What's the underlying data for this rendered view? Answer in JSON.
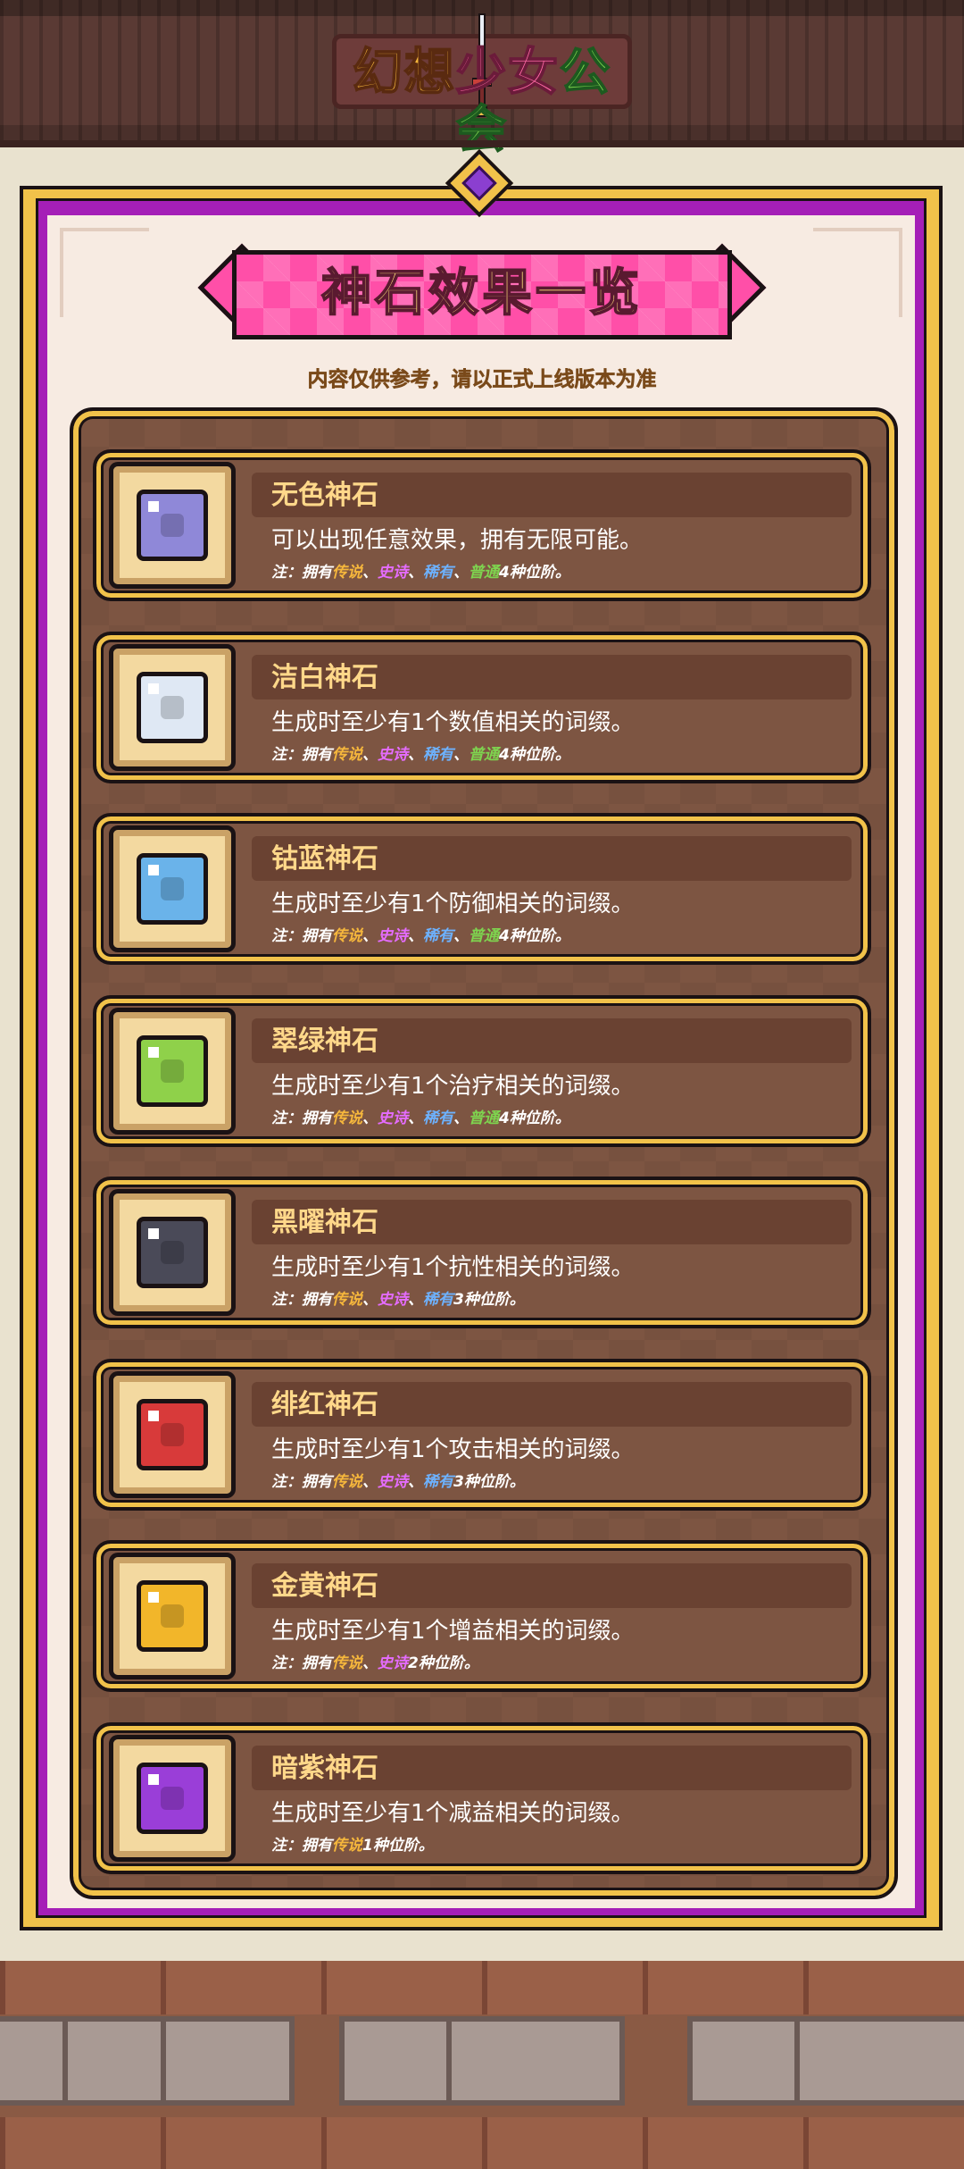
{
  "logo": {
    "part1": "幻想",
    "part2": "少女",
    "part3": "公会"
  },
  "title": "神石效果一览",
  "subtitle": "内容仅供参考，请以正式上线版本为准",
  "colors": {
    "legend": "#f6b73c",
    "epic": "#e56cff",
    "rare": "#6db2ff",
    "common": "#7ed44f",
    "frame": "#a51fb7",
    "title_bg": "#ff4fa8"
  },
  "stones": [
    {
      "name": "无色神石",
      "desc": "可以出现任意效果，拥有无限可能。",
      "gem_color": "#8f88d8",
      "icon": "colorless-stone-icon",
      "note": {
        "prefix": "注：拥有",
        "tiers": [
          "传说",
          "史诗",
          "稀有",
          "普通"
        ],
        "seps": [
          "、",
          "、",
          "、"
        ],
        "suffix": "4种位阶。"
      }
    },
    {
      "name": "洁白神石",
      "desc": "生成时至少有1个数值相关的词缀。",
      "gem_color": "#dfe8f4",
      "icon": "white-stone-icon",
      "note": {
        "prefix": "注：拥有",
        "tiers": [
          "传说",
          "史诗",
          "稀有",
          "普通"
        ],
        "seps": [
          "、",
          "、",
          "、"
        ],
        "suffix": "4种位阶。"
      }
    },
    {
      "name": "钴蓝神石",
      "desc": "生成时至少有1个防御相关的词缀。",
      "gem_color": "#6ab3ea",
      "icon": "cobalt-stone-icon",
      "note": {
        "prefix": "注：拥有",
        "tiers": [
          "传说",
          "史诗",
          "稀有",
          "普通"
        ],
        "seps": [
          "、",
          "、",
          "、"
        ],
        "suffix": "4种位阶。"
      }
    },
    {
      "name": "翠绿神石",
      "desc": "生成时至少有1个治疗相关的词缀。",
      "gem_color": "#8fd14a",
      "icon": "emerald-stone-icon",
      "note": {
        "prefix": "注：拥有",
        "tiers": [
          "传说",
          "史诗",
          "稀有",
          "普通"
        ],
        "seps": [
          "、",
          "、",
          "、"
        ],
        "suffix": "4种位阶。"
      }
    },
    {
      "name": "黑曜神石",
      "desc": "生成时至少有1个抗性相关的词缀。",
      "gem_color": "#4a4a58",
      "icon": "obsidian-stone-icon",
      "note": {
        "prefix": "注：拥有",
        "tiers": [
          "传说",
          "史诗",
          "稀有"
        ],
        "seps": [
          "、",
          "、"
        ],
        "suffix": "3种位阶。"
      }
    },
    {
      "name": "绯红神石",
      "desc": "生成时至少有1个攻击相关的词缀。",
      "gem_color": "#d83a3a",
      "icon": "crimson-stone-icon",
      "note": {
        "prefix": "注：拥有",
        "tiers": [
          "传说",
          "史诗",
          "稀有"
        ],
        "seps": [
          "、",
          "、"
        ],
        "suffix": "3种位阶。"
      }
    },
    {
      "name": "金黄神石",
      "desc": "生成时至少有1个增益相关的词缀。",
      "gem_color": "#f2b62a",
      "icon": "golden-stone-icon",
      "note": {
        "prefix": "注：拥有",
        "tiers": [
          "传说",
          "史诗"
        ],
        "seps": [
          "、"
        ],
        "suffix": "2种位阶。"
      }
    },
    {
      "name": "暗紫神石",
      "desc": "生成时至少有1个减益相关的词缀。",
      "gem_color": "#9a3ed8",
      "icon": "dark-purple-stone-icon",
      "note": {
        "prefix": "注：拥有",
        "tiers": [
          "传说"
        ],
        "seps": [],
        "suffix": "1种位阶。"
      }
    }
  ]
}
